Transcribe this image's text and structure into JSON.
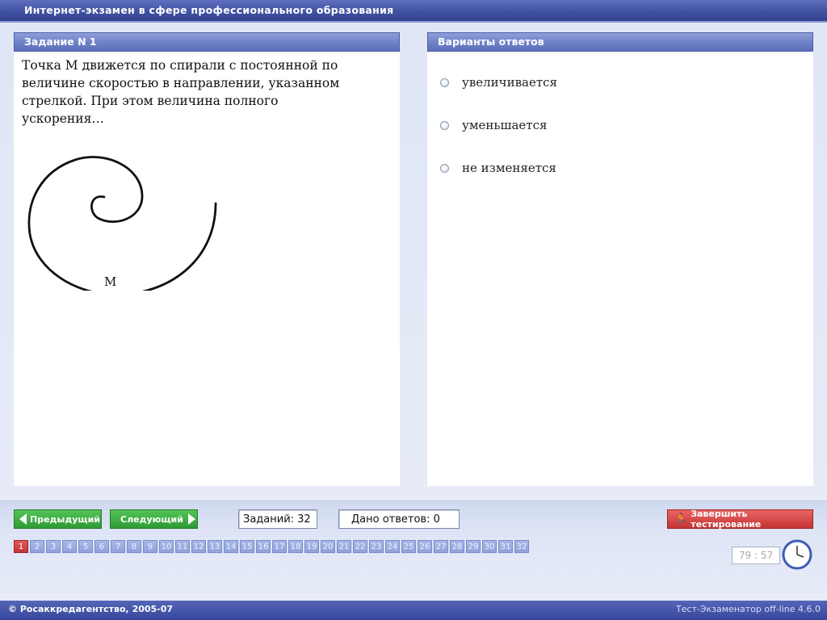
{
  "window": {
    "title": "Интернет-экзамен в сфере профессионального образования"
  },
  "task": {
    "header": "Задание N 1",
    "text": "Точка М движется по спирали с постоянной по величине скоростью в направлении, указанном стрелкой. При этом величина полного ускорения…",
    "figure_point_label": "М"
  },
  "answers": {
    "header": "Варианты ответов",
    "options": [
      "увеличивается",
      "уменьшается",
      "не изменяется"
    ],
    "selected": null
  },
  "navigation": {
    "prev_label": "Предыдущий",
    "next_label": "Следующий",
    "tasks_count_text": "Заданий: 32",
    "answers_given_text": "Дано ответов: 0",
    "finish_label": "Завершить тестирование",
    "current_page": 1,
    "pages": [
      "1",
      "2",
      "3",
      "4",
      "5",
      "6",
      "7",
      "8",
      "9",
      "10",
      "11",
      "12",
      "13",
      "14",
      "15",
      "16",
      "17",
      "18",
      "19",
      "20",
      "21",
      "22",
      "23",
      "24",
      "25",
      "26",
      "27",
      "28",
      "29",
      "30",
      "31",
      "32"
    ]
  },
  "timer": {
    "text": "79 : 57"
  },
  "footer": {
    "copyright": "© Росаккредагентство, 2005-07",
    "version": "Тест-Экзаменатор off-line 4.6.0"
  },
  "colors": {
    "title_bar": "#3f4f9f",
    "panel_header": "#6e81c7",
    "nav_button": "#2f9a34",
    "finish_button": "#c43434",
    "active_page": "#c13535"
  }
}
